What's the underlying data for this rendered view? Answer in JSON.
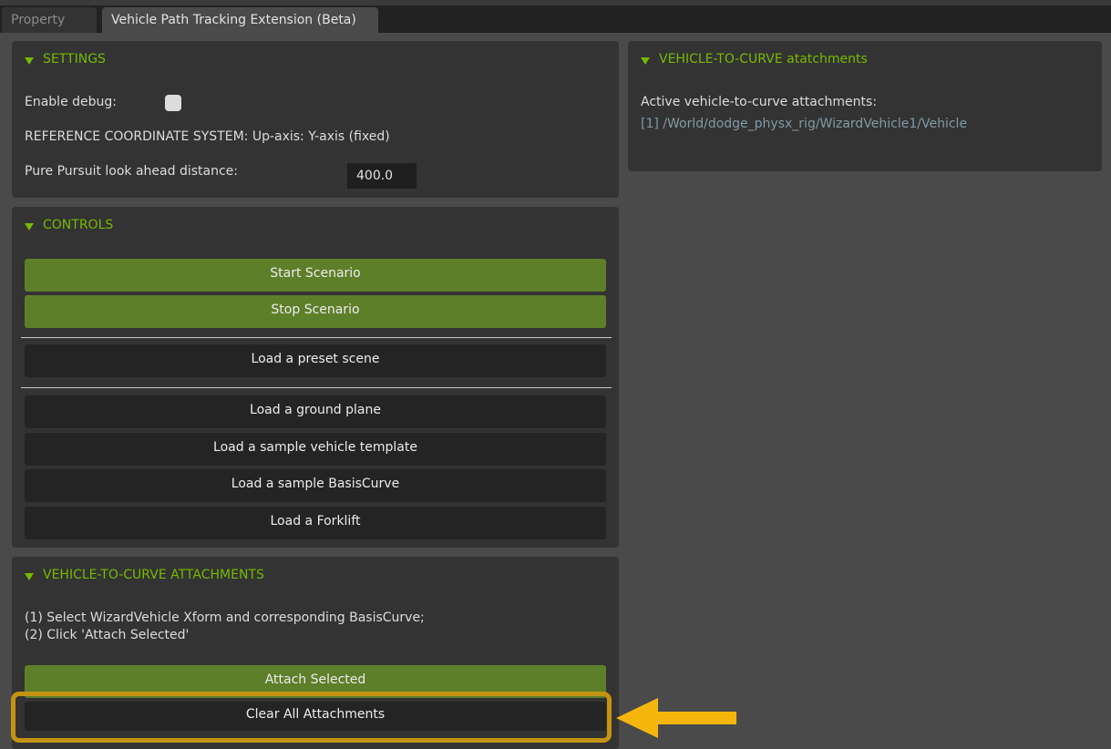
{
  "tabs": [
    {
      "label": "Property",
      "active": false
    },
    {
      "label": "Vehicle Path Tracking Extension (Beta)",
      "active": true
    }
  ],
  "settings": {
    "title": "SETTINGS",
    "enable_debug_label": "Enable debug:",
    "enable_debug_checked": false,
    "reference_text": "REFERENCE COORDINATE SYSTEM: Up-axis: Y-axis (fixed)",
    "lookahead_label": "Pure Pursuit look ahead distance:",
    "lookahead_value": "400.0"
  },
  "controls": {
    "title": "CONTROLS",
    "start_label": "Start Scenario",
    "stop_label": "Stop Scenario",
    "preset_label": "Load a preset scene",
    "ground_label": "Load a ground plane",
    "vehicle_label": "Load a sample vehicle template",
    "curve_label": "Load a sample BasisCurve",
    "forklift_label": "Load a Forklift"
  },
  "attachments": {
    "title": "VEHICLE-TO-CURVE ATTACHMENTS",
    "instruction_1": "(1) Select WizardVehicle Xform and corresponding BasisCurve;",
    "instruction_2": "(2) Click 'Attach Selected'",
    "attach_label": "Attach Selected",
    "clear_label": "Clear All Attachments"
  },
  "right_panel": {
    "title": "VEHICLE-TO-CURVE atatchments",
    "active_label": "Active vehicle-to-curve attachments:",
    "items": [
      "[1] /World/dodge_physx_rig/WizardVehicle1/Vehicle"
    ]
  },
  "colors": {
    "accent": "#76b900",
    "green_button": "#5e7f2a",
    "highlight": "#c59312",
    "link": "#7f9aa6"
  }
}
